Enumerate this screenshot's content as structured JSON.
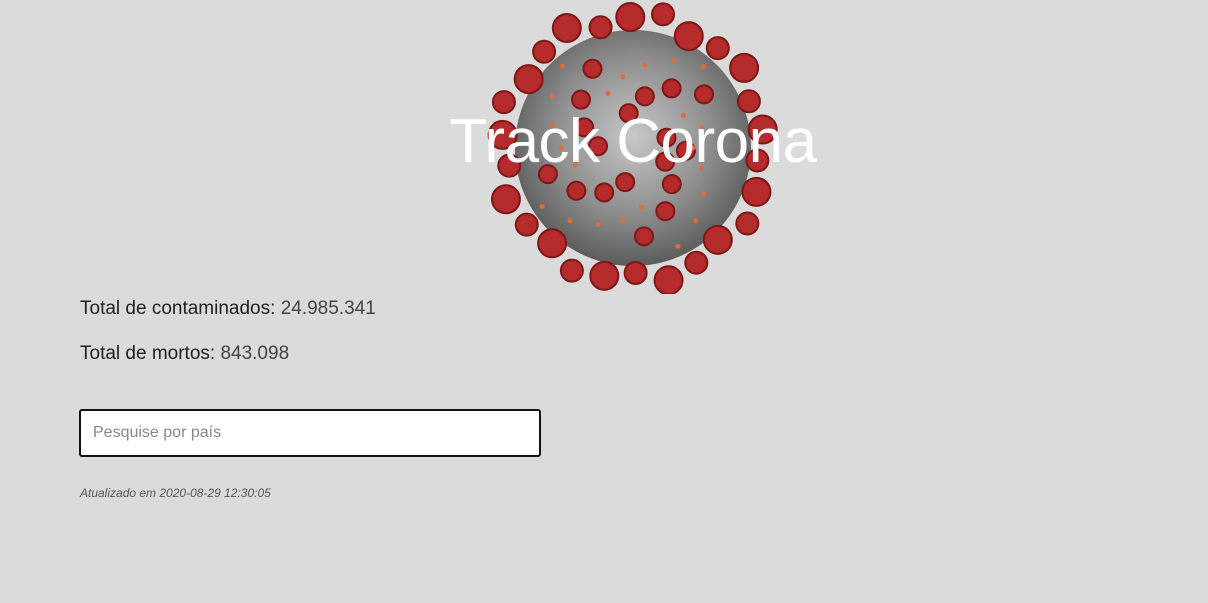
{
  "header": {
    "title": "Track Corona",
    "image_icon": "coronavirus-illustration"
  },
  "stats": {
    "infected_label": "Total de contaminados:",
    "infected_value": "24.985.341",
    "deaths_label": "Total de mortos:",
    "deaths_value": "843.098"
  },
  "search": {
    "placeholder": "Pesquise por país",
    "value": ""
  },
  "footer": {
    "updated_text": "Atualizado em 2020-08-29 12:30:05"
  },
  "colors": {
    "background": "#dcdbdb",
    "spike": "#b52a2a",
    "virus_body": "#9a9a9a",
    "title": "#ffffff"
  }
}
